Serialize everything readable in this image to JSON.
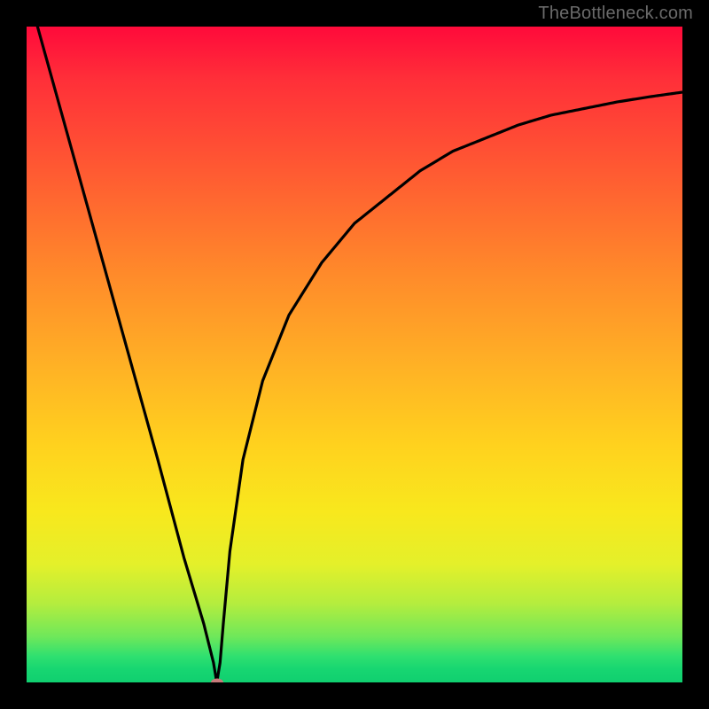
{
  "watermark": "TheBottleneck.com",
  "chart_data": {
    "type": "line",
    "title": "",
    "xlabel": "",
    "ylabel": "",
    "xlim": [
      0,
      1
    ],
    "ylim": [
      0,
      1
    ],
    "series": [
      {
        "name": "curve",
        "x": [
          0.0,
          0.05,
          0.1,
          0.15,
          0.2,
          0.24,
          0.27,
          0.285,
          0.29,
          0.295,
          0.3,
          0.31,
          0.33,
          0.36,
          0.4,
          0.45,
          0.5,
          0.55,
          0.6,
          0.65,
          0.7,
          0.75,
          0.8,
          0.85,
          0.9,
          0.95,
          1.0
        ],
        "y": [
          1.06,
          0.88,
          0.7,
          0.52,
          0.34,
          0.19,
          0.09,
          0.03,
          0.0,
          0.03,
          0.09,
          0.2,
          0.34,
          0.46,
          0.56,
          0.64,
          0.7,
          0.74,
          0.78,
          0.81,
          0.83,
          0.85,
          0.865,
          0.875,
          0.885,
          0.893,
          0.9
        ]
      }
    ],
    "minimum_point": {
      "x": 0.29,
      "y": 0.0
    },
    "gradient_colors": {
      "top": "#ff0a3a",
      "middle": "#ffd21e",
      "bottom": "#10cf70"
    }
  }
}
